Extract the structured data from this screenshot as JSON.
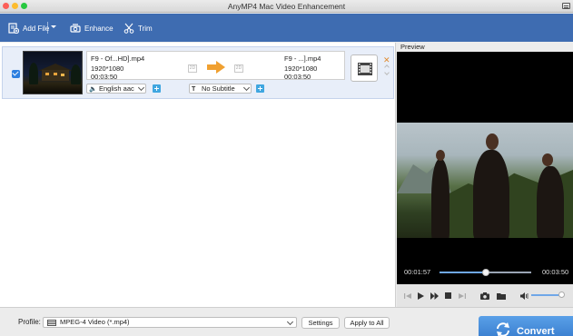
{
  "window": {
    "title": "AnyMP4 Mac Video Enhancement"
  },
  "toolbar": {
    "add_file": "Add File",
    "enhance": "Enhance",
    "trim": "Trim"
  },
  "file_item": {
    "source_name": "F9 - Of...HD].mp4",
    "source_resolution": "1920*1080",
    "source_duration": "00:03:50",
    "output_name": "F9 - ...].mp4",
    "output_resolution": "1920*1080",
    "output_duration": "00:03:50",
    "audio_track": "English aac",
    "subtitle": "No Subtitle",
    "checked": true,
    "badge_2d": "2D"
  },
  "preview": {
    "label": "Preview",
    "current_time": "00:01:57",
    "total_time": "00:03:50",
    "progress": 0.509,
    "volume": 0.88
  },
  "bottom": {
    "profile_label": "Profile:",
    "profile_value": "MPEG-4 Video (*.mp4)",
    "settings": "Settings",
    "apply_to_all": "Apply to All",
    "convert": "Convert"
  },
  "colors": {
    "toolbar": "#3e6cb1",
    "accent": "#3a7fd0",
    "arrow": "#f0a030"
  }
}
